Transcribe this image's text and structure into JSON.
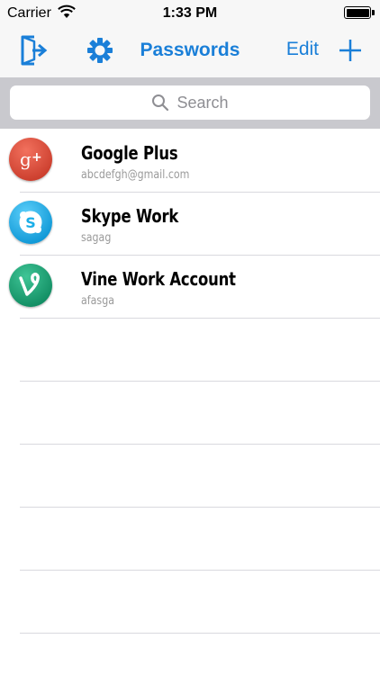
{
  "status_bar": {
    "carrier": "Carrier",
    "time": "1:33 PM"
  },
  "nav_bar": {
    "title": "Passwords",
    "edit_label": "Edit",
    "accent_color": "#1a7fd8"
  },
  "search": {
    "placeholder": "Search"
  },
  "accounts": [
    {
      "name": "Google Plus",
      "username": "abcdefgh@gmail.com",
      "icon": "google-plus-icon",
      "icon_color": "#dd4b39",
      "icon_glyph": "g+"
    },
    {
      "name": "Skype Work",
      "username": "sagag",
      "icon": "skype-icon",
      "icon_color": "#1aaee8",
      "icon_glyph": "S"
    },
    {
      "name": "Vine Work Account",
      "username": "afasga",
      "icon": "vine-icon",
      "icon_color": "#1aa57a",
      "icon_glyph": "V"
    }
  ]
}
